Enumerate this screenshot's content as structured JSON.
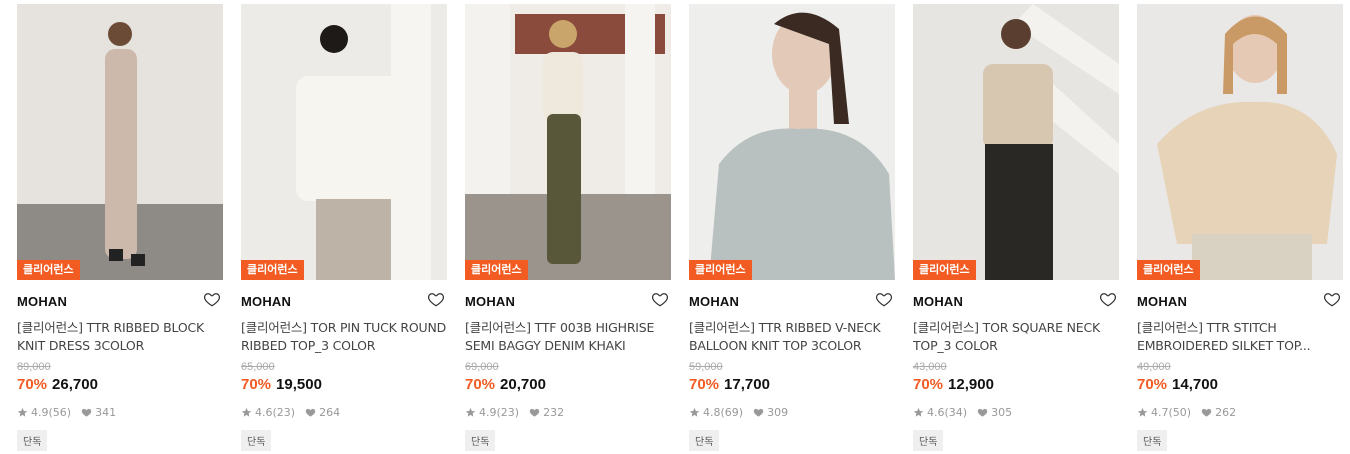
{
  "colors": {
    "badge_bg": "#f25c22",
    "discount": "#f25c22"
  },
  "products": [
    {
      "badge": "클리어런스",
      "brand": "MOHAN",
      "name": "[클리어런스] TTR RIBBED BLOCK KNIT DRESS 3COLOR",
      "original_price": "89,000",
      "discount": "70%",
      "price": "26,700",
      "rating": "4.9",
      "reviews": "(56)",
      "likes": "341",
      "tag": "단독",
      "icon_star": "star-icon",
      "icon_heart": "heart-icon"
    },
    {
      "badge": "클리어런스",
      "brand": "MOHAN",
      "name": "[클리어런스] TOR PIN TUCK ROUND RIBBED TOP_3 COLOR",
      "original_price": "65,000",
      "discount": "70%",
      "price": "19,500",
      "rating": "4.6",
      "reviews": "(23)",
      "likes": "264",
      "tag": "단독"
    },
    {
      "badge": "클리어런스",
      "brand": "MOHAN",
      "name": "[클리어런스] TTF 003B HIGHRISE SEMI BAGGY DENIM KHAKI",
      "original_price": "69,000",
      "discount": "70%",
      "price": "20,700",
      "rating": "4.9",
      "reviews": "(23)",
      "likes": "232",
      "tag": "단독"
    },
    {
      "badge": "클리어런스",
      "brand": "MOHAN",
      "name": "[클리어런스] TTR RIBBED V-NECK BALLOON KNIT TOP 3COLOR",
      "original_price": "59,000",
      "discount": "70%",
      "price": "17,700",
      "rating": "4.8",
      "reviews": "(69)",
      "likes": "309",
      "tag": "단독"
    },
    {
      "badge": "클리어런스",
      "brand": "MOHAN",
      "name": "[클리어런스] TOR SQUARE NECK TOP_3 COLOR",
      "original_price": "43,000",
      "discount": "70%",
      "price": "12,900",
      "rating": "4.6",
      "reviews": "(34)",
      "likes": "305",
      "tag": "단독"
    },
    {
      "badge": "클리어런스",
      "brand": "MOHAN",
      "name": "[클리어런스] TTR STITCH EMBROIDERED SILKET TOP...",
      "original_price": "49,000",
      "discount": "70%",
      "price": "14,700",
      "rating": "4.7",
      "reviews": "(50)",
      "likes": "262",
      "tag": "단독"
    }
  ]
}
